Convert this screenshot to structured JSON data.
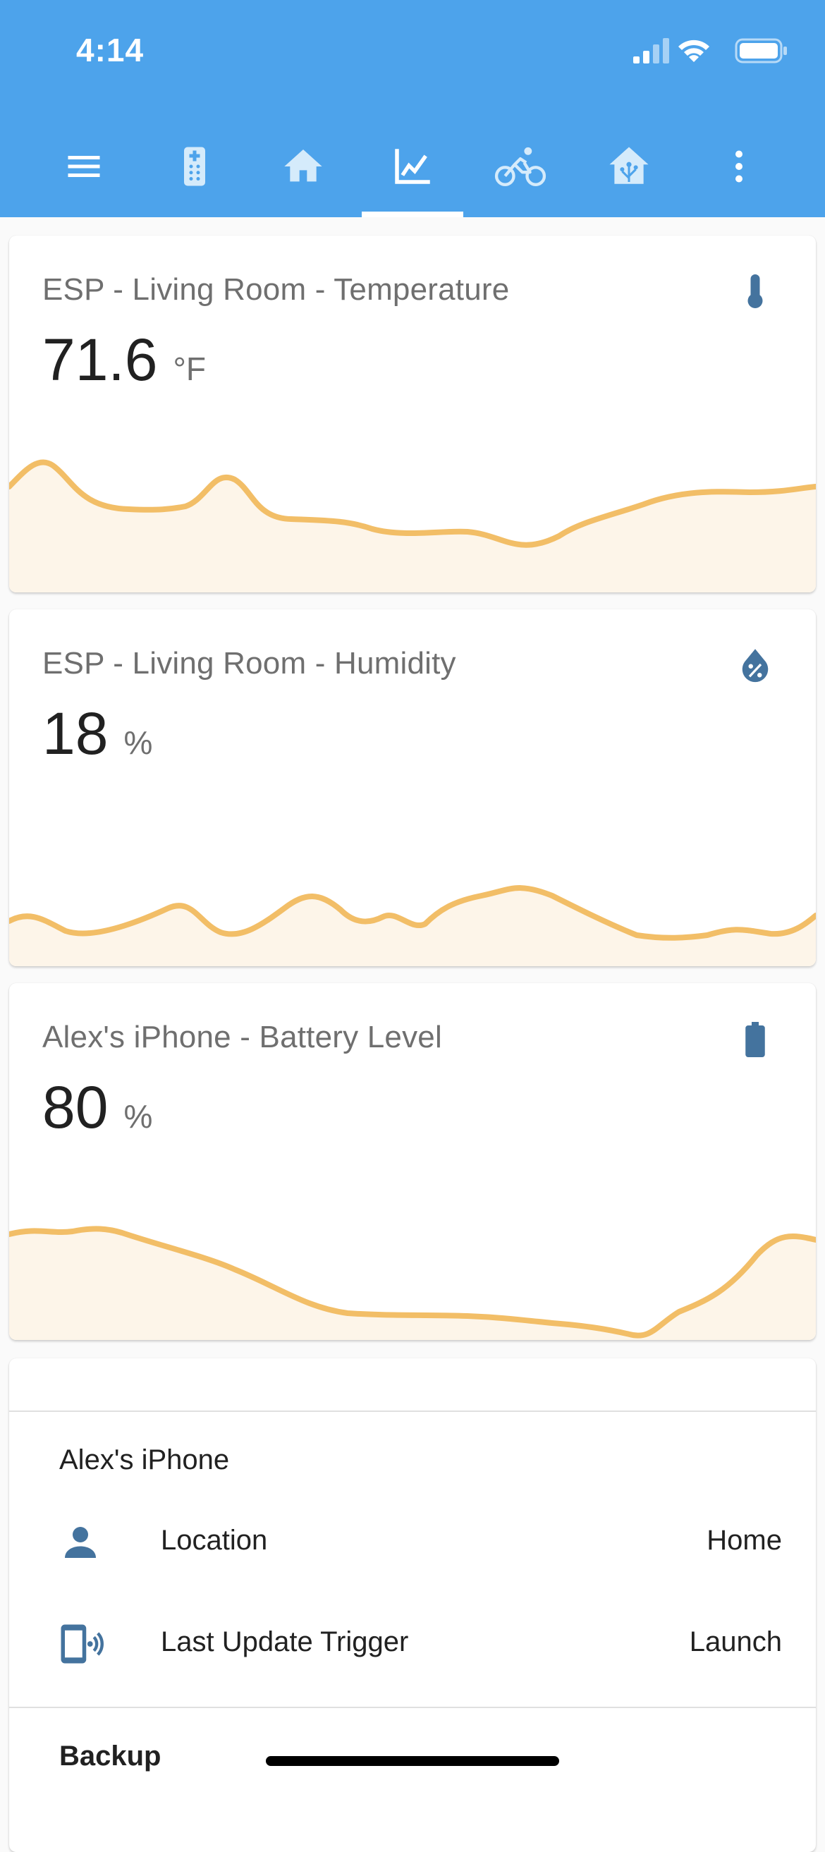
{
  "status_bar": {
    "time": "4:14"
  },
  "nav": {
    "items": [
      {
        "icon": "menu-icon"
      },
      {
        "icon": "remote-icon"
      },
      {
        "icon": "home-icon"
      },
      {
        "icon": "chart-line-icon",
        "active": true
      },
      {
        "icon": "bike-icon"
      },
      {
        "icon": "home-assistant-icon"
      },
      {
        "icon": "more-vertical-icon"
      }
    ]
  },
  "cards": [
    {
      "title": "ESP - Living Room - Temperature",
      "value": "71.6",
      "unit": "°F",
      "icon": "thermometer-icon"
    },
    {
      "title": "ESP - Living Room - Humidity",
      "value": "18",
      "unit": "%",
      "icon": "water-percent-icon"
    },
    {
      "title": "Alex's iPhone - Battery Level",
      "value": "80",
      "unit": "%",
      "icon": "battery-icon"
    }
  ],
  "entities": {
    "group_title": "Alex's iPhone",
    "rows": [
      {
        "icon": "account-icon",
        "name": "Location",
        "state": "Home"
      },
      {
        "icon": "cellphone-wireless-icon",
        "name": "Last Update Trigger",
        "state": "Launch"
      }
    ],
    "next_group_title": "Backup"
  },
  "colors": {
    "header": "#4da3eb",
    "graph_line": "#f2be67",
    "graph_fill": "#fdf5e9",
    "icon": "#44739e"
  }
}
